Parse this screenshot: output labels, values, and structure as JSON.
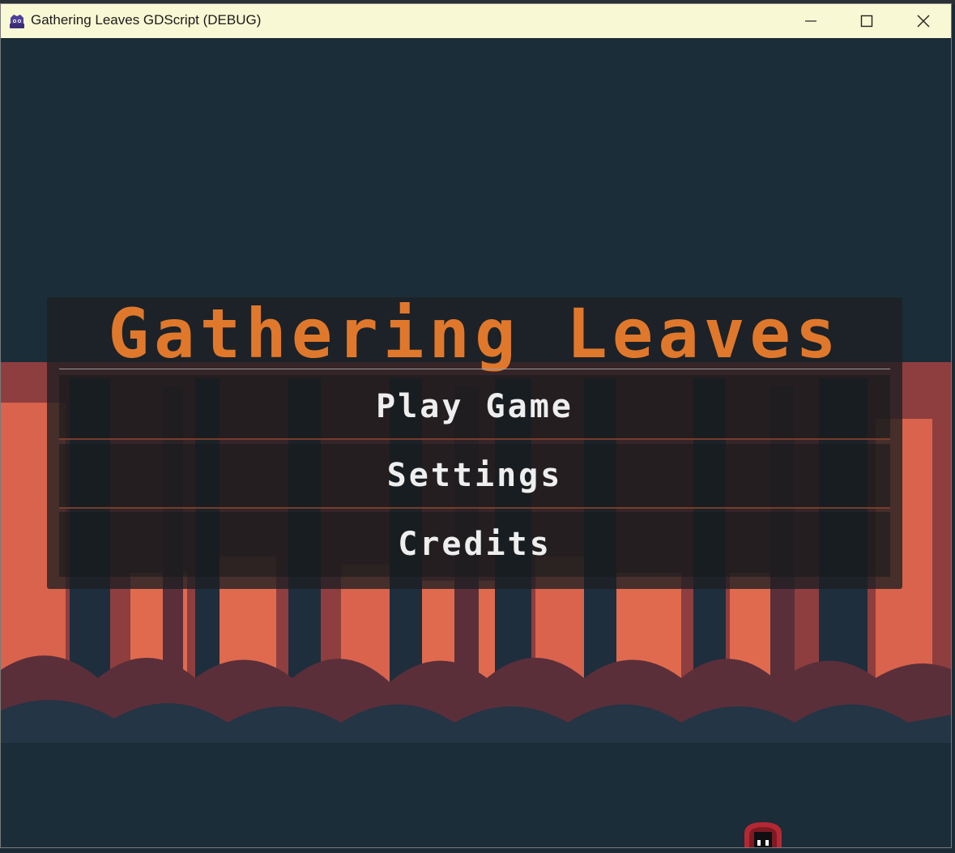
{
  "window": {
    "title": "Gathering Leaves GDScript (DEBUG)",
    "controls": {
      "minimize": "minimize",
      "maximize": "maximize",
      "close": "close"
    }
  },
  "game": {
    "title": "Gathering Leaves",
    "menu": [
      {
        "id": "play",
        "label": "Play Game"
      },
      {
        "id": "settings",
        "label": "Settings"
      },
      {
        "id": "credits",
        "label": "Credits"
      }
    ]
  },
  "colors": {
    "titlebar": "#f9f8d4",
    "background": "#1b2d38",
    "title_accent": "#e0782c",
    "button_text": "#eeeeee",
    "forest_light": "#e06a4e",
    "forest_mid": "#8e3e3f",
    "forest_dark": "#5a2f3a"
  },
  "icons": {
    "app": "godot-app-icon",
    "minimize": "minimize-icon",
    "maximize": "maximize-icon",
    "close": "close-icon",
    "player": "hooded-player-sprite"
  }
}
